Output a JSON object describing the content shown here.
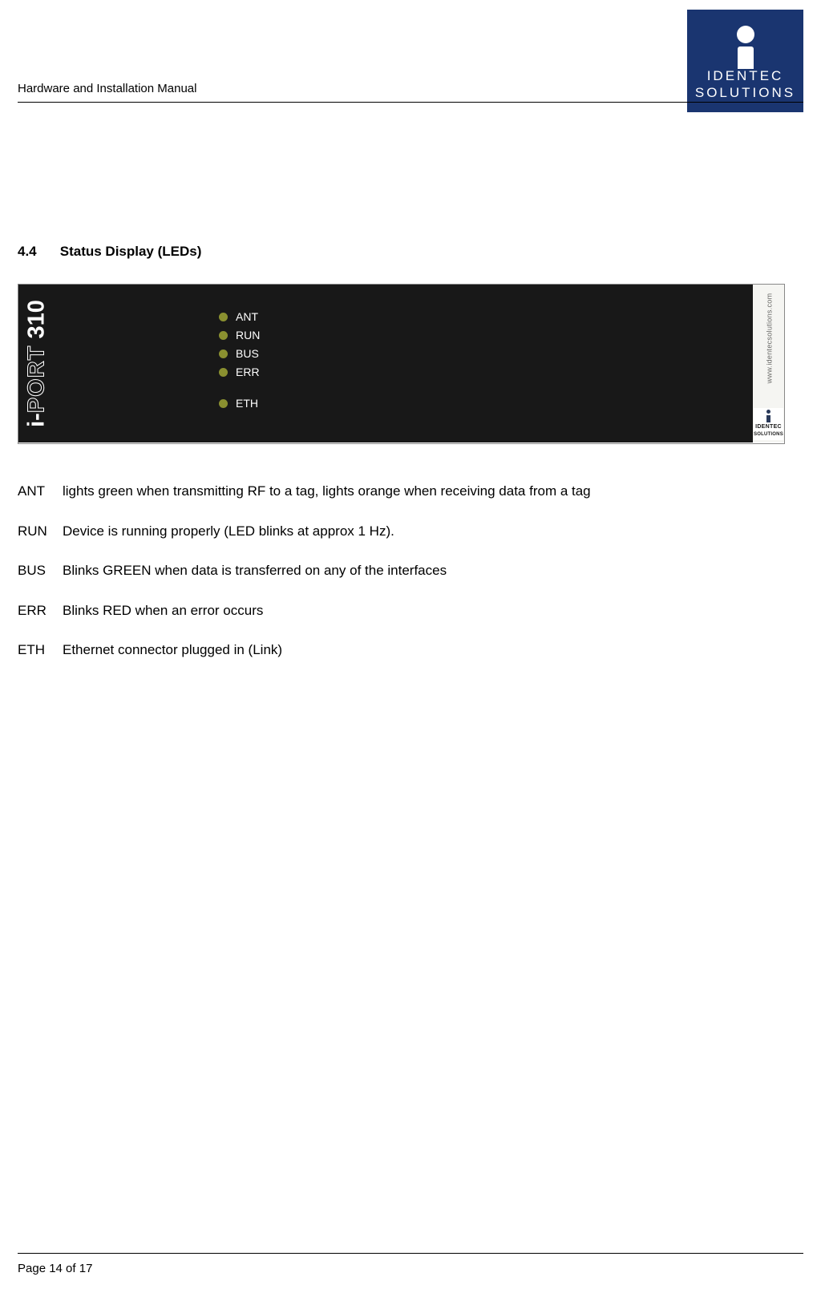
{
  "header": {
    "title": "Hardware and Installation Manual",
    "logo_line1": "IDENTEC",
    "logo_line2": "SOLUTIONS"
  },
  "section": {
    "number": "4.4",
    "title": "Status Display (LEDs)"
  },
  "device_panel": {
    "brand_text": "i-PORT 310",
    "leds": [
      "ANT",
      "RUN",
      "BUS",
      "ERR",
      "ETH"
    ],
    "url": "www.identecsolutions.com",
    "minilogo_line1": "IDENTEC",
    "minilogo_line2": "SOLUTIONS"
  },
  "definitions": [
    {
      "term": "ANT",
      "desc": "lights green when transmitting RF to a tag, lights orange when receiving data from a tag"
    },
    {
      "term": "RUN",
      "desc": "Device is running properly (LED blinks at approx 1 Hz)."
    },
    {
      "term": "BUS",
      "desc": "Blinks GREEN when data is transferred on any of the interfaces"
    },
    {
      "term": "ERR",
      "desc": "Blinks RED when an error occurs"
    },
    {
      "term": "ETH",
      "desc": "Ethernet connector plugged in (Link)"
    }
  ],
  "footer": {
    "page_label": "Page 14 of 17"
  }
}
